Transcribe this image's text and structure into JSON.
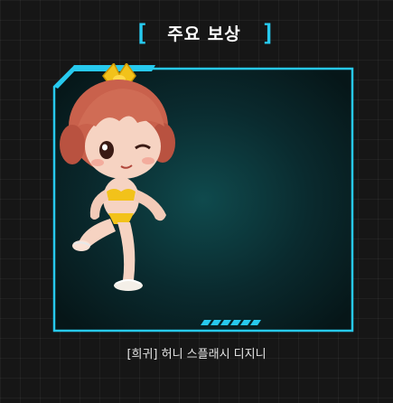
{
  "header": {
    "bracket_left": "[",
    "title": "주요 보상",
    "bracket_right": "]"
  },
  "reward": {
    "name": "[희귀] 허니 스플래시 디지니"
  },
  "colors": {
    "accent": "#27c9ee",
    "panel_bg": "#0c3437",
    "page_bg": "#161616",
    "text": "#e6e6e6"
  }
}
